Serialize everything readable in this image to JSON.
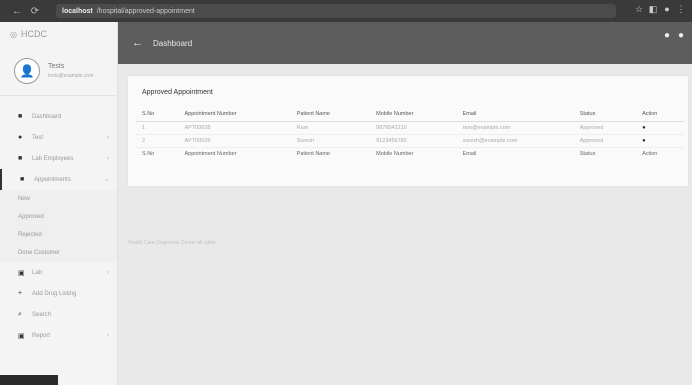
{
  "browser": {
    "back": "←",
    "reload": "⟳",
    "url_host": "localhost",
    "url_path": "/hospital/approved-appointment"
  },
  "brand": {
    "name": "HCDC"
  },
  "user": {
    "name": "Tests",
    "subtitle": "tests@example.com"
  },
  "sidebar": {
    "items": [
      {
        "label": "Dashboard",
        "icon": "home-icon"
      },
      {
        "label": "Test",
        "icon": "flask-icon"
      },
      {
        "label": "Lab Employees",
        "icon": "users-icon"
      },
      {
        "label": "Appointments",
        "icon": "calendar-icon"
      }
    ],
    "submenu": [
      "New",
      "Approved",
      "Rejected",
      "Done Customer"
    ],
    "items2": [
      {
        "label": "Lab",
        "icon": "building-icon"
      },
      {
        "label": "Add Drug Listing",
        "icon": "plus-icon"
      },
      {
        "label": "Search",
        "icon": "search-icon"
      },
      {
        "label": "Report",
        "icon": "report-icon"
      }
    ]
  },
  "topnav": {
    "title": "Dashboard"
  },
  "card": {
    "title": "Approved Appointment",
    "columns": [
      "S.No",
      "Appointment Number",
      "Patient Name",
      "Mobile Number",
      "Email",
      "Status",
      "Action"
    ],
    "rows": [
      [
        "1",
        "APT00028",
        "Ram",
        "9876543210",
        "ram@example.com",
        "Approved",
        "●"
      ],
      [
        "2",
        "APT00029",
        "Suresh",
        "9123456780",
        "suresh@example.com",
        "Approved",
        "●"
      ]
    ],
    "footer": [
      "S.No",
      "Appointment Number",
      "Patient Name",
      "Mobile Number",
      "Email",
      "Status",
      "Action"
    ]
  },
  "footer_text": "Health Care Diagnostic Center all rights"
}
